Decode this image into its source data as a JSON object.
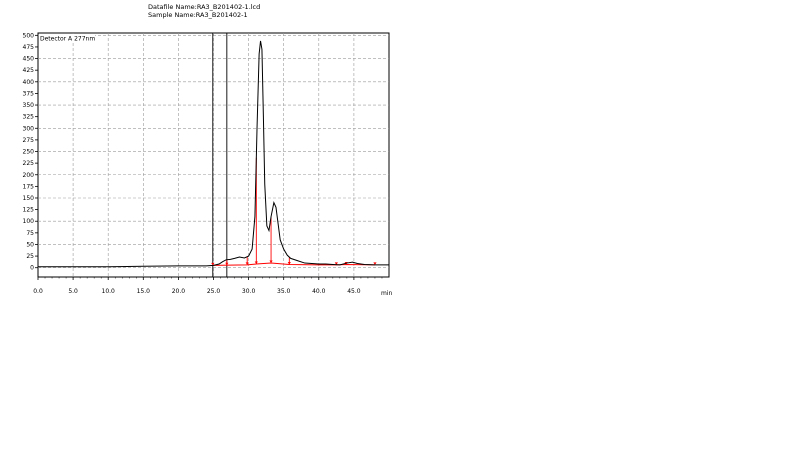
{
  "header": {
    "datafile_line": "Datafile Name:RA3_B201402-1.lcd",
    "sample_line": "Sample Name:RA3_B201402-1"
  },
  "chart_data": {
    "type": "line",
    "detector_label": "Detector A 277nm",
    "xunit": "min",
    "xlim": [
      0,
      50
    ],
    "ylim": [
      -20,
      505
    ],
    "x_ticks": [
      0,
      5,
      10,
      15,
      20,
      25,
      30,
      35,
      40,
      45
    ],
    "x_tick_labels": [
      "0.0",
      "5.0",
      "10.0",
      "15.0",
      "20.0",
      "25.0",
      "30.0",
      "35.0",
      "40.0",
      "45.0"
    ],
    "y_ticks": [
      0,
      25,
      50,
      75,
      100,
      125,
      150,
      175,
      200,
      225,
      250,
      275,
      300,
      325,
      350,
      375,
      400,
      425,
      450,
      475,
      500
    ],
    "y_tick_labels": [
      "0",
      "25",
      "50",
      "75",
      "100",
      "125",
      "150",
      "175",
      "200",
      "225",
      "250",
      "275",
      "300",
      "325",
      "350",
      "375",
      "400",
      "425",
      "450",
      "475",
      "500"
    ],
    "grid": true,
    "vertical_markers": [
      24.9,
      26.9
    ],
    "series": [
      {
        "color": "#000000",
        "points": [
          [
            0,
            2
          ],
          [
            10,
            2
          ],
          [
            15,
            3
          ],
          [
            20,
            4
          ],
          [
            24,
            4
          ],
          [
            25,
            5
          ],
          [
            25.8,
            8
          ],
          [
            26.3,
            13
          ],
          [
            26.8,
            17
          ],
          [
            27.4,
            18
          ],
          [
            28,
            20
          ],
          [
            28.7,
            23
          ],
          [
            29.4,
            21
          ],
          [
            30,
            25
          ],
          [
            30.5,
            40
          ],
          [
            30.9,
            110
          ],
          [
            31.2,
            300
          ],
          [
            31.5,
            460
          ],
          [
            31.7,
            488
          ],
          [
            31.9,
            470
          ],
          [
            32.1,
            330
          ],
          [
            32.3,
            180
          ],
          [
            32.6,
            90
          ],
          [
            32.9,
            80
          ],
          [
            33.2,
            110
          ],
          [
            33.6,
            140
          ],
          [
            33.9,
            130
          ],
          [
            34.2,
            95
          ],
          [
            34.5,
            60
          ],
          [
            35,
            40
          ],
          [
            35.5,
            27
          ],
          [
            36,
            20
          ],
          [
            37,
            15
          ],
          [
            38,
            10
          ],
          [
            39,
            9
          ],
          [
            40,
            8
          ],
          [
            41,
            8
          ],
          [
            42,
            7
          ],
          [
            43,
            6
          ],
          [
            44,
            10
          ],
          [
            44.8,
            12
          ],
          [
            45.5,
            9
          ],
          [
            46.5,
            7
          ],
          [
            48,
            6
          ],
          [
            50,
            6
          ]
        ]
      }
    ],
    "integration_baseline": {
      "color": "#ff0000",
      "points": [
        [
          24.9,
          5
        ],
        [
          29.8,
          6
        ],
        [
          31.1,
          8
        ],
        [
          33.2,
          10
        ],
        [
          35.8,
          7
        ],
        [
          40,
          6
        ],
        [
          42.5,
          6
        ],
        [
          43.9,
          7
        ],
        [
          48,
          6
        ]
      ]
    },
    "peak_dividers": [
      24.9,
      26.9,
      29.8,
      31.1,
      33.2,
      35.8,
      42.5,
      43.9,
      48.0
    ]
  }
}
